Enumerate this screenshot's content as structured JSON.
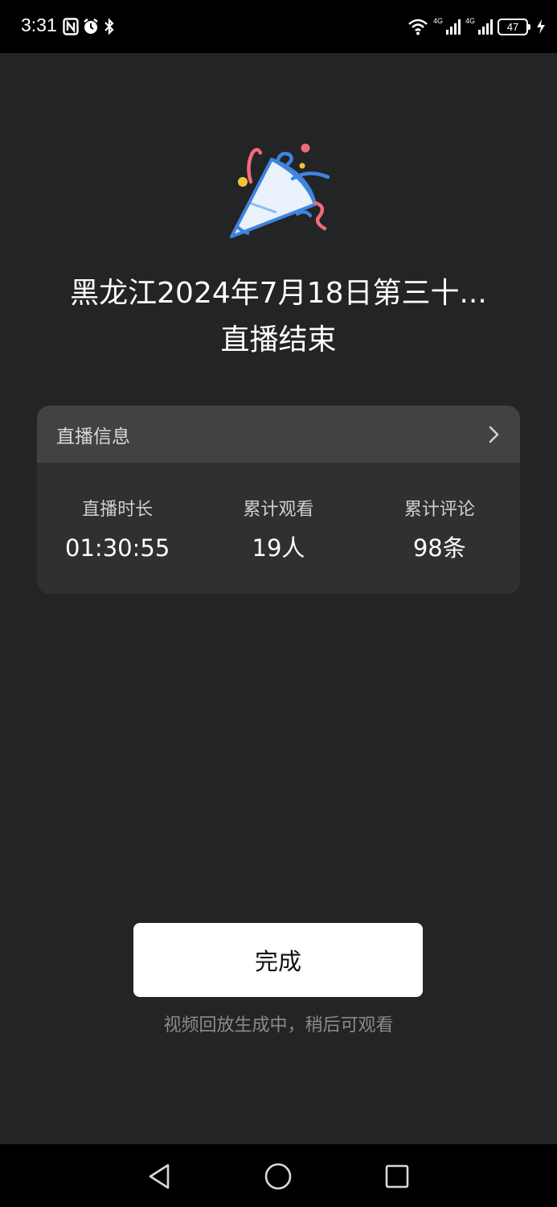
{
  "status_bar": {
    "time": "3:31",
    "left_icons": [
      "nfc-icon",
      "alarm-icon",
      "bluetooth-icon"
    ],
    "network_labels": [
      "4G",
      "4G"
    ],
    "battery": "47"
  },
  "title": "黑龙江2024年7月18日第三十...",
  "subtitle": "直播结束",
  "info_card": {
    "header_label": "直播信息",
    "stats": [
      {
        "label": "直播时长",
        "value": "01:30:55"
      },
      {
        "label": "累计观看",
        "value": "19人"
      },
      {
        "label": "累计评论",
        "value": "98条"
      }
    ]
  },
  "done_button_label": "完成",
  "replay_note": "视频回放生成中，稍后可观看",
  "nav": [
    "back-icon",
    "home-icon",
    "recents-icon"
  ],
  "colors": {
    "background": "#222425",
    "card": "#2f3031",
    "card_header": "#414242",
    "party_blue": "#3f84e0",
    "party_red": "#f06b7a",
    "party_yellow": "#f3c43b"
  }
}
